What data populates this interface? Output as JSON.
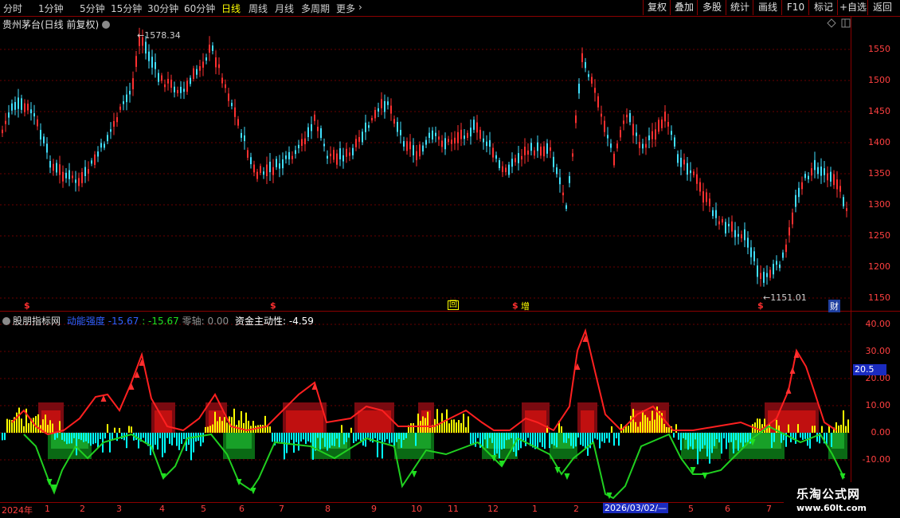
{
  "toolbar": {
    "periods": [
      "分时",
      "1分钟",
      "5分钟",
      "15分钟",
      "30分钟",
      "60分钟",
      "日线",
      "周线",
      "月线",
      "多周期",
      "更多"
    ],
    "active_period": "日线",
    "buttons": [
      "复权",
      "叠加",
      "多股",
      "统计",
      "画线",
      "F10",
      "标记",
      "+自选",
      "返回"
    ]
  },
  "main_chart": {
    "title": "贵州茅台(日线 前复权)",
    "high_label": "1578.34",
    "low_label": "1151.01",
    "y_axis_labels": [
      "1550",
      "1500",
      "1450",
      "1400",
      "1350",
      "1300",
      "1250",
      "1200",
      "1150"
    ],
    "markers": [
      "$",
      "$",
      "回",
      "$",
      "增",
      "$",
      "财"
    ]
  },
  "indicator": {
    "name": "股朋指标网",
    "series1_name": "动能强度",
    "series1_value": "-15.67",
    "series2_value": ": -15.67",
    "zero_axis_label": "零轴",
    "zero_axis_value": "0.00",
    "fund_label": "资金主动性",
    "fund_value": ": -4.59",
    "current_tag": "20.5",
    "y_axis_labels": [
      "40.00",
      "30.00",
      "20.00",
      "10.00",
      "0.00",
      "-10.00"
    ]
  },
  "x_axis": {
    "labels": [
      "2024年",
      "1",
      "2",
      "3",
      "4",
      "5",
      "6",
      "7",
      "8",
      "9",
      "10",
      "11",
      "12",
      "1",
      "2",
      "2026/03/02/—",
      "5",
      "6",
      "7"
    ]
  },
  "watermark": {
    "line1": "乐淘公式网",
    "line2": "www.60lt.com"
  },
  "colors": {
    "up": "#ff3030",
    "down": "#40e0ff",
    "accent": "#ffff00",
    "frame": "#8b0000",
    "green": "#20c020",
    "cyan": "#00ffff"
  }
}
